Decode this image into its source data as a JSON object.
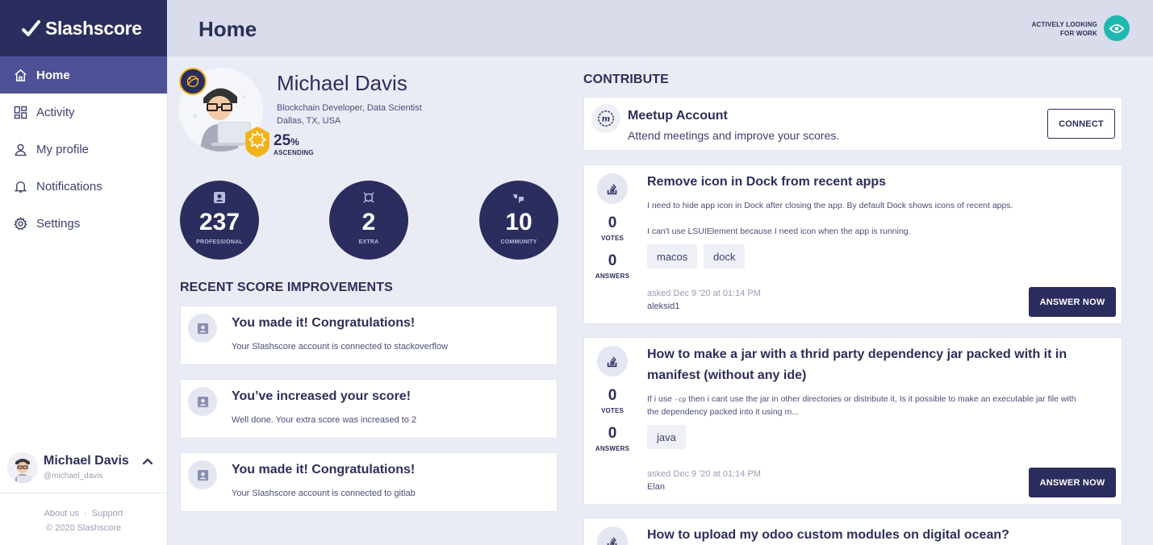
{
  "brand": {
    "name": "Slashscore"
  },
  "sidebar": {
    "items": [
      {
        "label": "Home",
        "icon": "home-icon",
        "active": true
      },
      {
        "label": "Activity",
        "icon": "dashboard-icon"
      },
      {
        "label": "My profile",
        "icon": "user-icon"
      },
      {
        "label": "Notifications",
        "icon": "bell-icon"
      },
      {
        "label": "Settings",
        "icon": "gear-icon"
      }
    ],
    "user": {
      "name": "Michael Davis",
      "handle": "@michael_davis"
    },
    "footer": {
      "about": "About us",
      "support": "Support",
      "copyright": "© 2020 Slashscore"
    }
  },
  "header": {
    "title": "Home",
    "status_line1": "ACTIVELY LOOKING",
    "status_line2": "FOR WORK"
  },
  "profile": {
    "name": "Michael Davis",
    "role": "Blockchain Developer, Data Scientist",
    "location": "Dallas, TX, USA",
    "percent": "25",
    "percent_unit": "%",
    "rank": "ASCENDING"
  },
  "scores": [
    {
      "value": "237",
      "label": "PROFESSIONAL",
      "icon": "id-card-icon"
    },
    {
      "value": "2",
      "label": "EXTRA",
      "icon": "extra-icon"
    },
    {
      "value": "10",
      "label": "COMMUNITY",
      "icon": "community-icon"
    }
  ],
  "improvements": {
    "title": "RECENT SCORE IMPROVEMENTS",
    "items": [
      {
        "title": "You made it! Congratulations!",
        "desc": "Your Slashscore account is connected to stackoverflow"
      },
      {
        "title": "You’ve increased your score!",
        "desc": "Well done. Your extra score was increased to 2"
      },
      {
        "title": "You made it! Congratulations!",
        "desc": "Your Slashscore account is connected to gitlab"
      }
    ]
  },
  "contribute": {
    "title": "CONTRIBUTE",
    "meetup": {
      "title": "Meetup Account",
      "desc": "Attend meetings and improve your scores.",
      "button": "CONNECT"
    },
    "questions": [
      {
        "title": "Remove icon in Dock from recent apps",
        "body1": "I need to hide app icon in Dock after closing the app. By default Dock shows icons of recent apps.",
        "body2": "I can't use LSUIElement because I need icon when the app is running.",
        "votes": "0",
        "votes_label": "VOTES",
        "answers": "0",
        "answers_label": "ANSWERS",
        "tags": [
          "macos",
          "dock"
        ],
        "asked": "asked Dec 9 '20 at 01:14 PM",
        "user": "aleksid1",
        "button": "ANSWER NOW"
      },
      {
        "title_line1": "How to make a jar with a thrid party dependency jar packed with it in",
        "title_line2": "manifest (without any ide)",
        "body_pre": "If i use",
        "body_code": "-cp",
        "body_post": "then i cant use the jar in other directories or distribute it, Is it possible to make an executable jar file with",
        "body_line2": "the dependency packed into it using m...",
        "votes": "0",
        "votes_label": "VOTES",
        "answers": "0",
        "answers_label": "ANSWERS",
        "tags": [
          "java"
        ],
        "asked": "asked Dec 9 '20 at 01:14 PM",
        "user": "Elan",
        "button": "ANSWER NOW"
      },
      {
        "title": "How to upload my odoo custom modules on digital ocean?"
      }
    ]
  },
  "colors": {
    "primary": "#2b2d5e",
    "active_nav": "#4e5196",
    "accent": "#1fb8b0",
    "gold": "#f2b21a",
    "background": "#e9ecf5"
  }
}
